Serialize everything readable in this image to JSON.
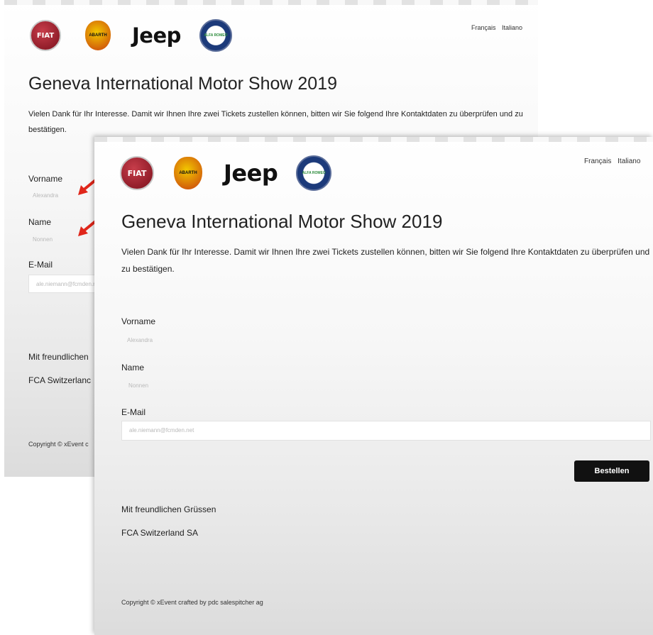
{
  "brands": {
    "fiat": "FIAT",
    "abarth": "ABARTH",
    "jeep": "Jeep",
    "alfa": "ALFA ROMEO"
  },
  "lang": {
    "fr": "Français",
    "it": "Italiano"
  },
  "title": "Geneva International Motor Show 2019",
  "intro": "Vielen Dank für Ihr Interesse. Damit wir Ihnen Ihre zwei Tickets zustellen können, bitten wir Sie folgend Ihre Kontaktdaten zu überprüfen und zu bestätigen.",
  "form": {
    "first_name_label": "Vorname",
    "first_name_value": "Alexandra",
    "name_label": "Name",
    "name_value": "Nonnen",
    "email_label": "E-Mail",
    "email_value": "ale.niemann@fcmden.net"
  },
  "submit_label": "Bestellen",
  "closing": {
    "greeting": "Mit freundlichen Grüssen",
    "company": "FCA Switzerland SA"
  },
  "copyright": "Copyright © xEvent crafted by pdc salespitcher ag",
  "back": {
    "greeting_partial": "Mit freundlichen",
    "company_partial": "FCA Switzerlanc",
    "copyright_partial": "Copyright © xEvent c"
  },
  "colors": {
    "annotation_arrow": "#e0261a",
    "button_bg": "#111111"
  }
}
